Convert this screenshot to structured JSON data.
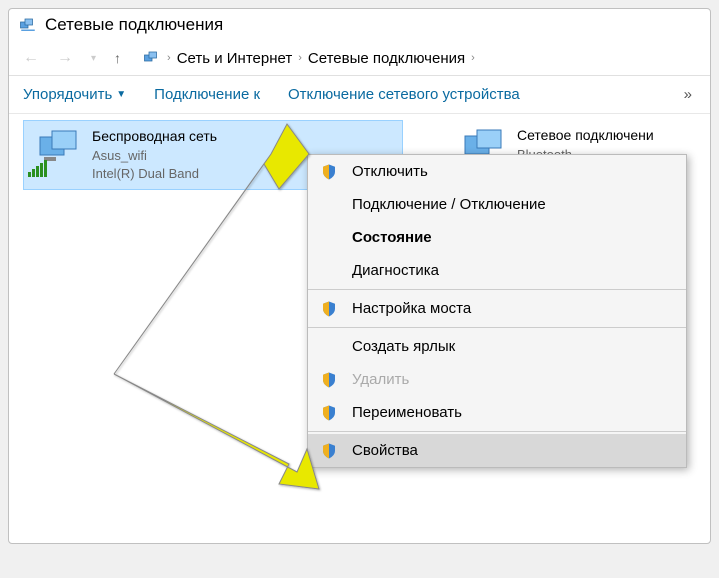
{
  "window": {
    "title": "Сетевые подключения"
  },
  "breadcrumb": {
    "items": [
      "Сеть и Интернет",
      "Сетевые подключения"
    ]
  },
  "toolbar": {
    "organize": "Упорядочить",
    "connect_to": "Подключение к",
    "disable_device": "Отключение сетевого устройства",
    "overflow": "»"
  },
  "adapters": [
    {
      "name": "Беспроводная сеть",
      "status": "Asus_wifi",
      "device": "Intel(R) Dual Band",
      "selected": true
    },
    {
      "name": "Сетевое подключени",
      "status": "Bluetooth",
      "device": "",
      "selected": false
    }
  ],
  "context_menu": {
    "items": [
      {
        "label": "Отключить",
        "shield": true,
        "bold": false
      },
      {
        "label": "Подключение / Отключение",
        "shield": false,
        "bold": false
      },
      {
        "label": "Состояние",
        "shield": false,
        "bold": true
      },
      {
        "label": "Диагностика",
        "shield": false,
        "bold": false
      },
      {
        "sep": true
      },
      {
        "label": "Настройка моста",
        "shield": true,
        "bold": false
      },
      {
        "sep": true
      },
      {
        "label": "Создать ярлык",
        "shield": false,
        "bold": false
      },
      {
        "label": "Удалить",
        "shield": true,
        "bold": false,
        "disabled": true
      },
      {
        "label": "Переименовать",
        "shield": true,
        "bold": false
      },
      {
        "sep": true
      },
      {
        "label": "Свойства",
        "shield": true,
        "bold": false,
        "highlighted": true
      }
    ]
  }
}
